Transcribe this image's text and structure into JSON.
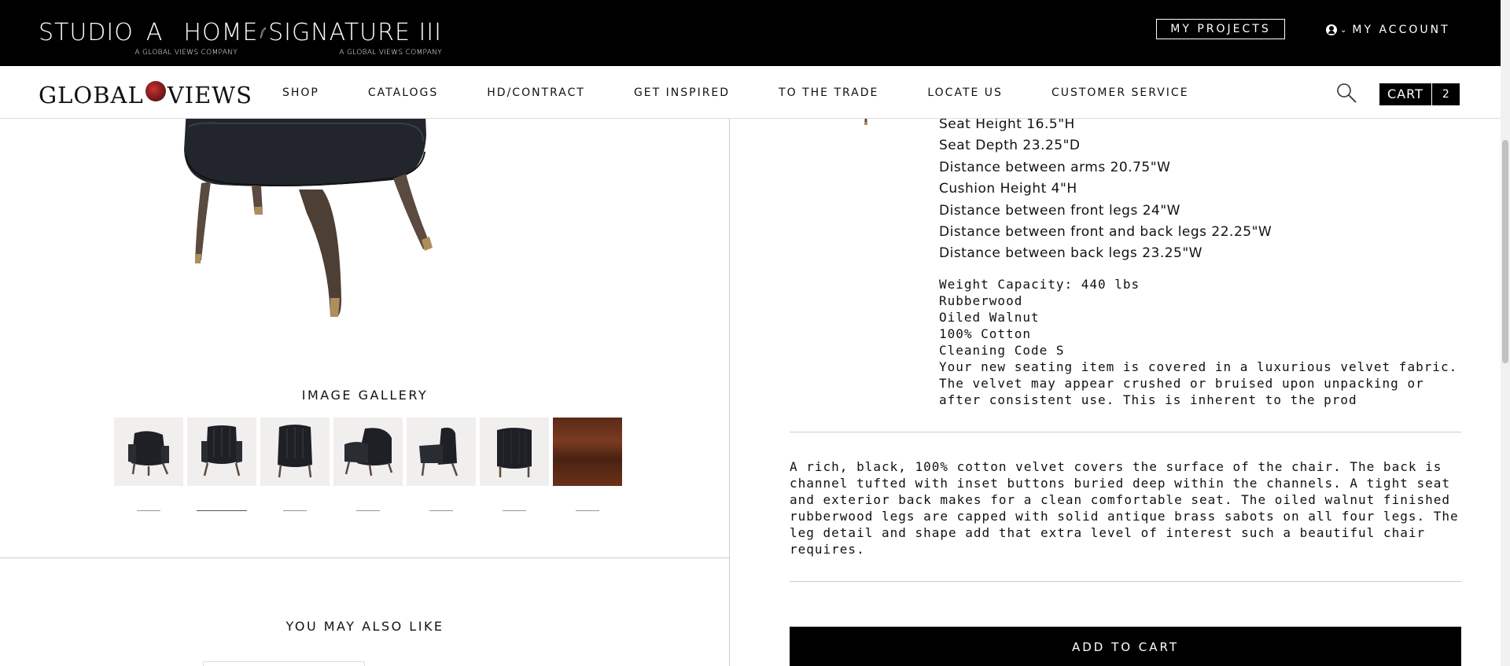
{
  "header": {
    "brand_studio_a": "STUDIO",
    "brand_studio_a_letter": "A",
    "brand_home": "HOME",
    "brand_studio_sub": "A GLOBAL VIEWS COMPANY",
    "brand_signature": "SIGNATURE III",
    "brand_signature_sub": "A GLOBAL VIEWS COMPANY",
    "my_projects": "MY PROJECTS",
    "my_account": "MY ACCOUNT"
  },
  "nav": {
    "logo_left": "GLOBAL",
    "logo_right": "VIEWS",
    "items": [
      "SHOP",
      "CATALOGS",
      "HD/CONTRACT",
      "GET INSPIRED",
      "TO THE TRADE",
      "LOCATE US",
      "CUSTOMER SERVICE"
    ],
    "cart_label": "CART",
    "cart_count": "2"
  },
  "gallery": {
    "title": "IMAGE GALLERY",
    "thumbnail_count": 7,
    "active_index": 1
  },
  "also_like": {
    "title": "YOU MAY ALSO LIKE"
  },
  "dimensions": [
    "Seat Height 16.5\"H",
    "Seat Depth 23.25\"D",
    "Distance between arms 20.75\"W",
    "Cushion Height 4\"H",
    "Distance between front legs 24\"W",
    "Distance between front and back legs 22.25\"W",
    "Distance between back legs 23.25\"W"
  ],
  "specs": [
    "Weight Capacity: 440 lbs",
    "Rubberwood",
    "Oiled Walnut",
    "100% Cotton",
    "Cleaning Code S",
    "Your new seating item is covered in a luxurious velvet fabric.",
    "The velvet may appear crushed or bruised upon unpacking or",
    "after consistent use. This is inherent to the prod"
  ],
  "description": [
    "A rich, black, 100% cotton velvet covers the surface of the chair. The back is",
    "channel tufted with inset buttons buried deep within the channels. A tight seat",
    "and exterior back makes for a clean comfortable seat. The oiled walnut finished",
    "rubberwood legs are capped with solid antique brass sabots on all four legs. The",
    "leg detail and shape add that extra level of interest such a beautiful chair",
    "requires."
  ],
  "actions": {
    "add_to_cart": "ADD TO CART"
  }
}
